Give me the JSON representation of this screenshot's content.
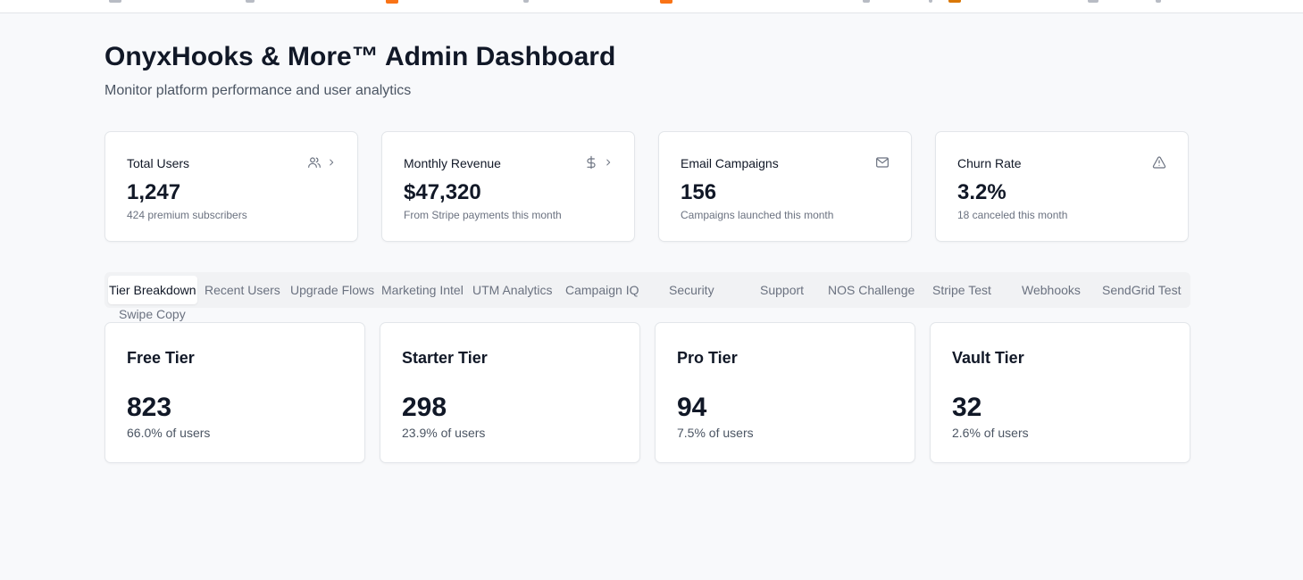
{
  "header": {
    "title": "OnyxHooks & More™ Admin Dashboard",
    "subtitle": "Monitor platform performance and user analytics"
  },
  "stats": [
    {
      "label": "Total Users",
      "value": "1,247",
      "desc": "424 premium subscribers",
      "icon": "users-icon"
    },
    {
      "label": "Monthly Revenue",
      "value": "$47,320",
      "desc": "From Stripe payments this month",
      "icon": "dollar-icon"
    },
    {
      "label": "Email Campaigns",
      "value": "156",
      "desc": "Campaigns launched this month",
      "icon": "mail-icon"
    },
    {
      "label": "Churn Rate",
      "value": "3.2%",
      "desc": "18 canceled this month",
      "icon": "alert-triangle-icon"
    }
  ],
  "tabs": [
    {
      "label": "Tier Breakdown",
      "active": true
    },
    {
      "label": "Recent Users"
    },
    {
      "label": "Upgrade Flows"
    },
    {
      "label": "Marketing Intel"
    },
    {
      "label": "UTM Analytics"
    },
    {
      "label": "Campaign IQ"
    },
    {
      "label": "Security"
    },
    {
      "label": "Support"
    },
    {
      "label": "NOS Challenge"
    },
    {
      "label": "Stripe Test"
    },
    {
      "label": "Webhooks"
    },
    {
      "label": "SendGrid Test"
    },
    {
      "label": "Swipe Copy"
    }
  ],
  "tiers": [
    {
      "name": "Free Tier",
      "count": "823",
      "pct": "66.0% of users"
    },
    {
      "name": "Starter Tier",
      "count": "298",
      "pct": "23.9% of users"
    },
    {
      "name": "Pro Tier",
      "count": "94",
      "pct": "7.5% of users"
    },
    {
      "name": "Vault Tier",
      "count": "32",
      "pct": "2.6% of users"
    }
  ],
  "colors": {
    "background": "#f8f9fb",
    "card": "#ffffff",
    "text": "#111827",
    "muted": "#6b7280",
    "tabs_bg": "#f1f2f4",
    "bookmark_accent": "#f97316"
  }
}
